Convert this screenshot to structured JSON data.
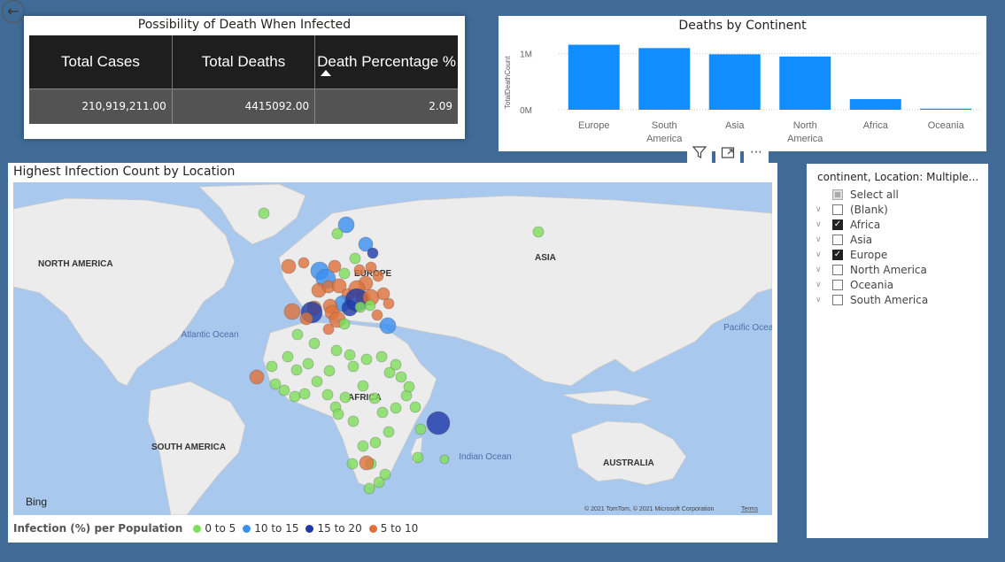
{
  "back_icon": "back-arrow-icon",
  "death_table": {
    "title": "Possibility of Death When Infected",
    "headers": [
      "Total Cases",
      "Total Deaths",
      "Death Percentage %"
    ],
    "values": [
      "210,919,211.00",
      "4415092.00",
      "2.09"
    ]
  },
  "chart_data": {
    "type": "bar",
    "title": "Deaths by Continent",
    "ylabel": "TotalDeathCount",
    "xlabel": "",
    "categories": [
      "Europe",
      "South America",
      "Asia",
      "North America",
      "Africa",
      "Oceania"
    ],
    "values": [
      1160000,
      1100000,
      990000,
      950000,
      190000,
      20000
    ],
    "ylim": [
      0,
      1200000
    ],
    "yticks": [
      {
        "value": 0,
        "label": "0M"
      },
      {
        "value": 1000000,
        "label": "1M"
      }
    ],
    "color": "#118dff"
  },
  "toolbar": {
    "filter_icon": "filter-icon",
    "focus_icon": "focus-mode-icon",
    "more_icon": "more-options-icon"
  },
  "map": {
    "title": "Highest Infection Count by Location",
    "labels": {
      "north_america": "NORTH AMERICA",
      "south_america": "SOUTH AMERICA",
      "europe": "EUROPE",
      "asia": "ASIA",
      "africa": "AFRICA",
      "australia": "AUSTRALIA",
      "atlantic": "Atlantic Ocean",
      "indian": "Indian Ocean",
      "pacific": "Pacific Ocean"
    },
    "attribution": "© 2021 TomTom, © 2021 Microsoft Corporation",
    "terms": "Terms",
    "bing": "Bing",
    "legend_title": "Infection (%) per Population",
    "legend": [
      {
        "label": "0 to 5",
        "color": "#7ee05a"
      },
      {
        "label": "10 to 15",
        "color": "#3a8ff0"
      },
      {
        "label": "15 to 20",
        "color": "#1f3aa8"
      },
      {
        "label": "5 to 10",
        "color": "#e0703a"
      }
    ]
  },
  "slicer": {
    "title": "continent, Location: Multiple...",
    "items": [
      {
        "label": "Select all",
        "state": "partial",
        "expandable": false
      },
      {
        "label": "(Blank)",
        "state": "unchecked",
        "expandable": true
      },
      {
        "label": "Africa",
        "state": "checked",
        "expandable": true
      },
      {
        "label": "Asia",
        "state": "unchecked",
        "expandable": true
      },
      {
        "label": "Europe",
        "state": "checked",
        "expandable": true
      },
      {
        "label": "North America",
        "state": "unchecked",
        "expandable": true
      },
      {
        "label": "Oceania",
        "state": "unchecked",
        "expandable": true
      },
      {
        "label": "South America",
        "state": "unchecked",
        "expandable": true
      }
    ]
  }
}
